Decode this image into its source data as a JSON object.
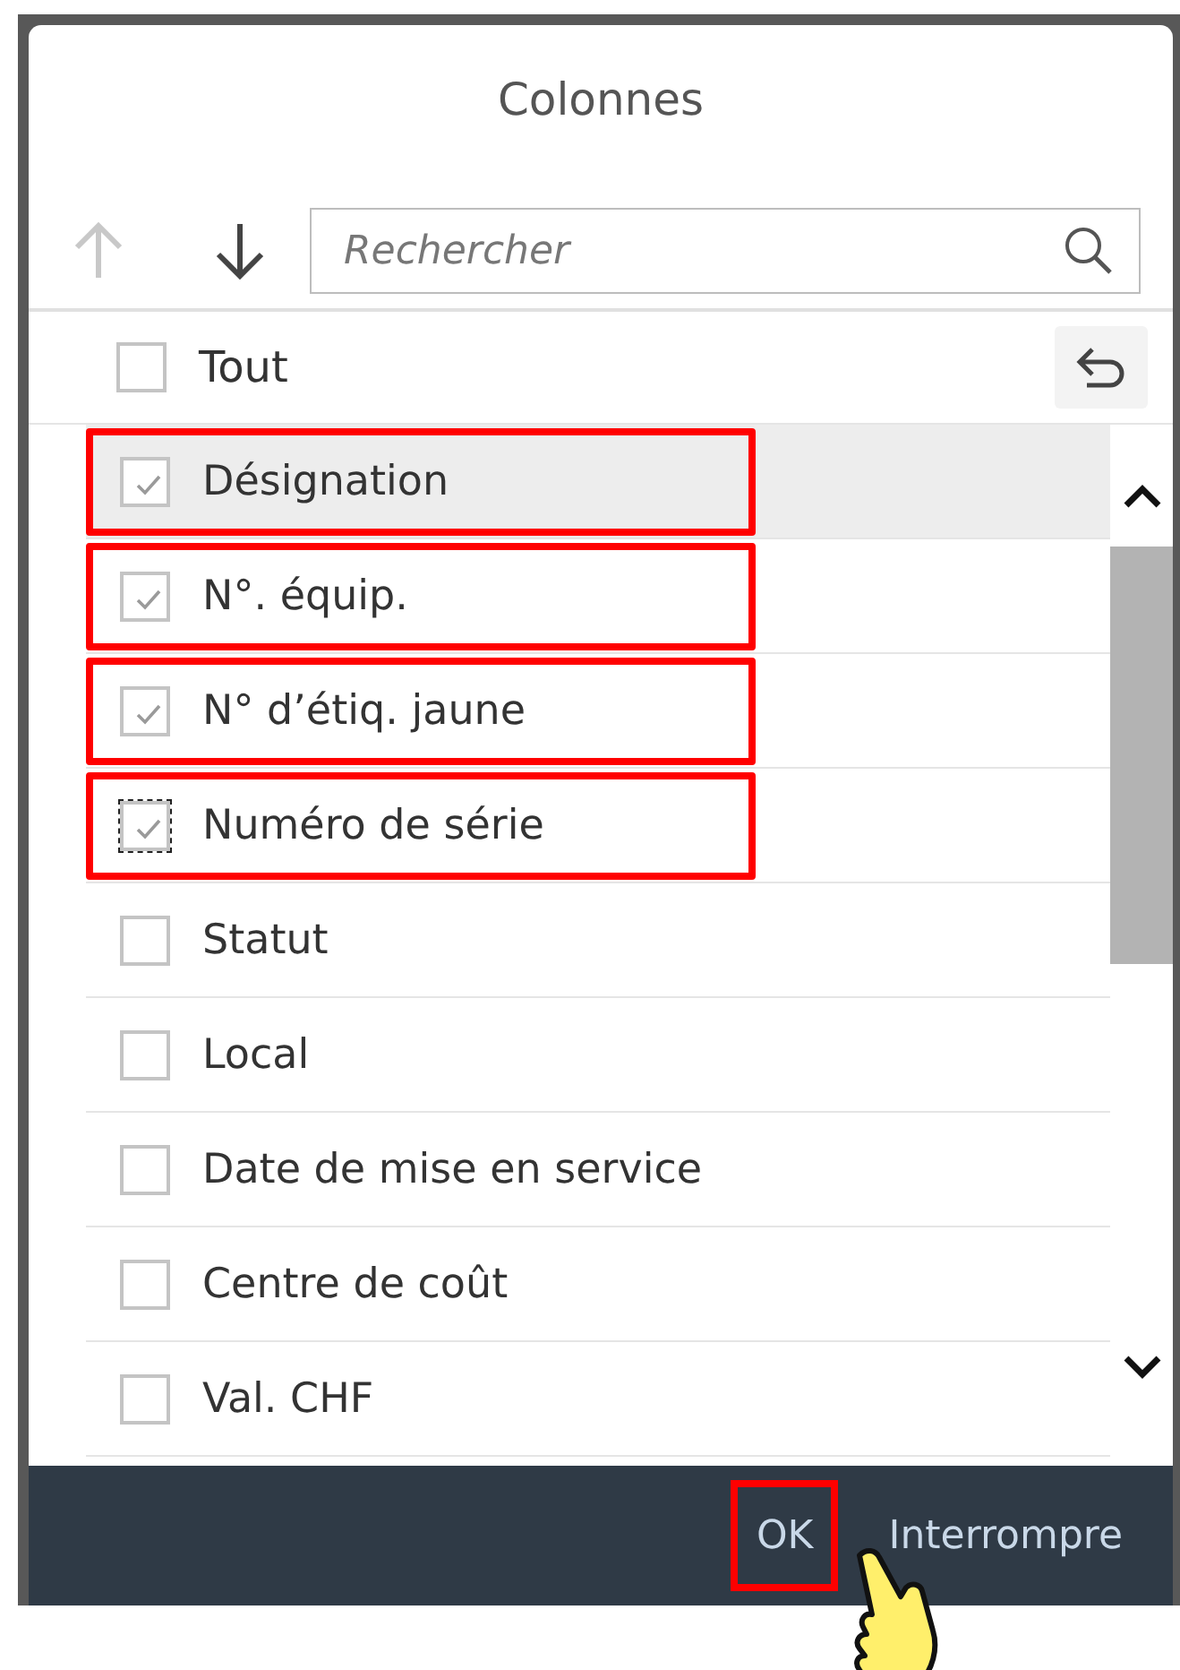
{
  "dialog": {
    "title": "Colonnes"
  },
  "toolbar": {
    "move_up": {
      "disabled": true
    },
    "move_down": {
      "disabled": false
    },
    "search": {
      "placeholder": "Rechercher"
    }
  },
  "select_all": {
    "label": "Tout",
    "checked": false
  },
  "items": [
    {
      "label": "Désignation",
      "checked": true,
      "hovered": true,
      "focused": false,
      "highlighted": true
    },
    {
      "label": "N°. équip.",
      "checked": true,
      "hovered": false,
      "focused": false,
      "highlighted": true
    },
    {
      "label": "N° d’étiq. jaune",
      "checked": true,
      "hovered": false,
      "focused": false,
      "highlighted": true
    },
    {
      "label": "Numéro de série",
      "checked": true,
      "hovered": false,
      "focused": true,
      "highlighted": true
    },
    {
      "label": "Statut",
      "checked": false,
      "hovered": false,
      "focused": false,
      "highlighted": false
    },
    {
      "label": "Local",
      "checked": false,
      "hovered": false,
      "focused": false,
      "highlighted": false
    },
    {
      "label": "Date de mise en service",
      "checked": false,
      "hovered": false,
      "focused": false,
      "highlighted": false
    },
    {
      "label": "Centre de coût",
      "checked": false,
      "hovered": false,
      "focused": false,
      "highlighted": false
    },
    {
      "label": "Val. CHF",
      "checked": false,
      "hovered": false,
      "focused": false,
      "highlighted": false
    }
  ],
  "footer": {
    "buttons": [
      {
        "label": "OK",
        "highlighted": true
      },
      {
        "label": "Interrompre",
        "highlighted": false
      }
    ]
  }
}
